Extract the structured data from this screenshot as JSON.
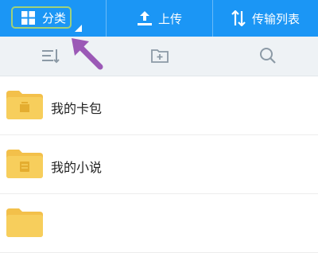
{
  "topbar": {
    "tabs": [
      {
        "label": "分类",
        "icon": "grid-icon"
      },
      {
        "label": "上传",
        "icon": "upload-icon"
      },
      {
        "label": "传输列表",
        "icon": "transfer-icon"
      }
    ]
  },
  "toolbar": {
    "tools": [
      {
        "icon": "sort-icon"
      },
      {
        "icon": "new-folder-icon"
      },
      {
        "icon": "search-icon"
      }
    ]
  },
  "files": [
    {
      "name": "我的卡包",
      "icon": "folder-icon"
    },
    {
      "name": "我的小说",
      "icon": "folder-icon"
    },
    {
      "name": "",
      "icon": "folder-icon"
    }
  ],
  "colors": {
    "topbar": "#1b96f5",
    "highlight": "#9fd17a",
    "arrow": "#9b59b6",
    "folder": "#f3c04a"
  }
}
